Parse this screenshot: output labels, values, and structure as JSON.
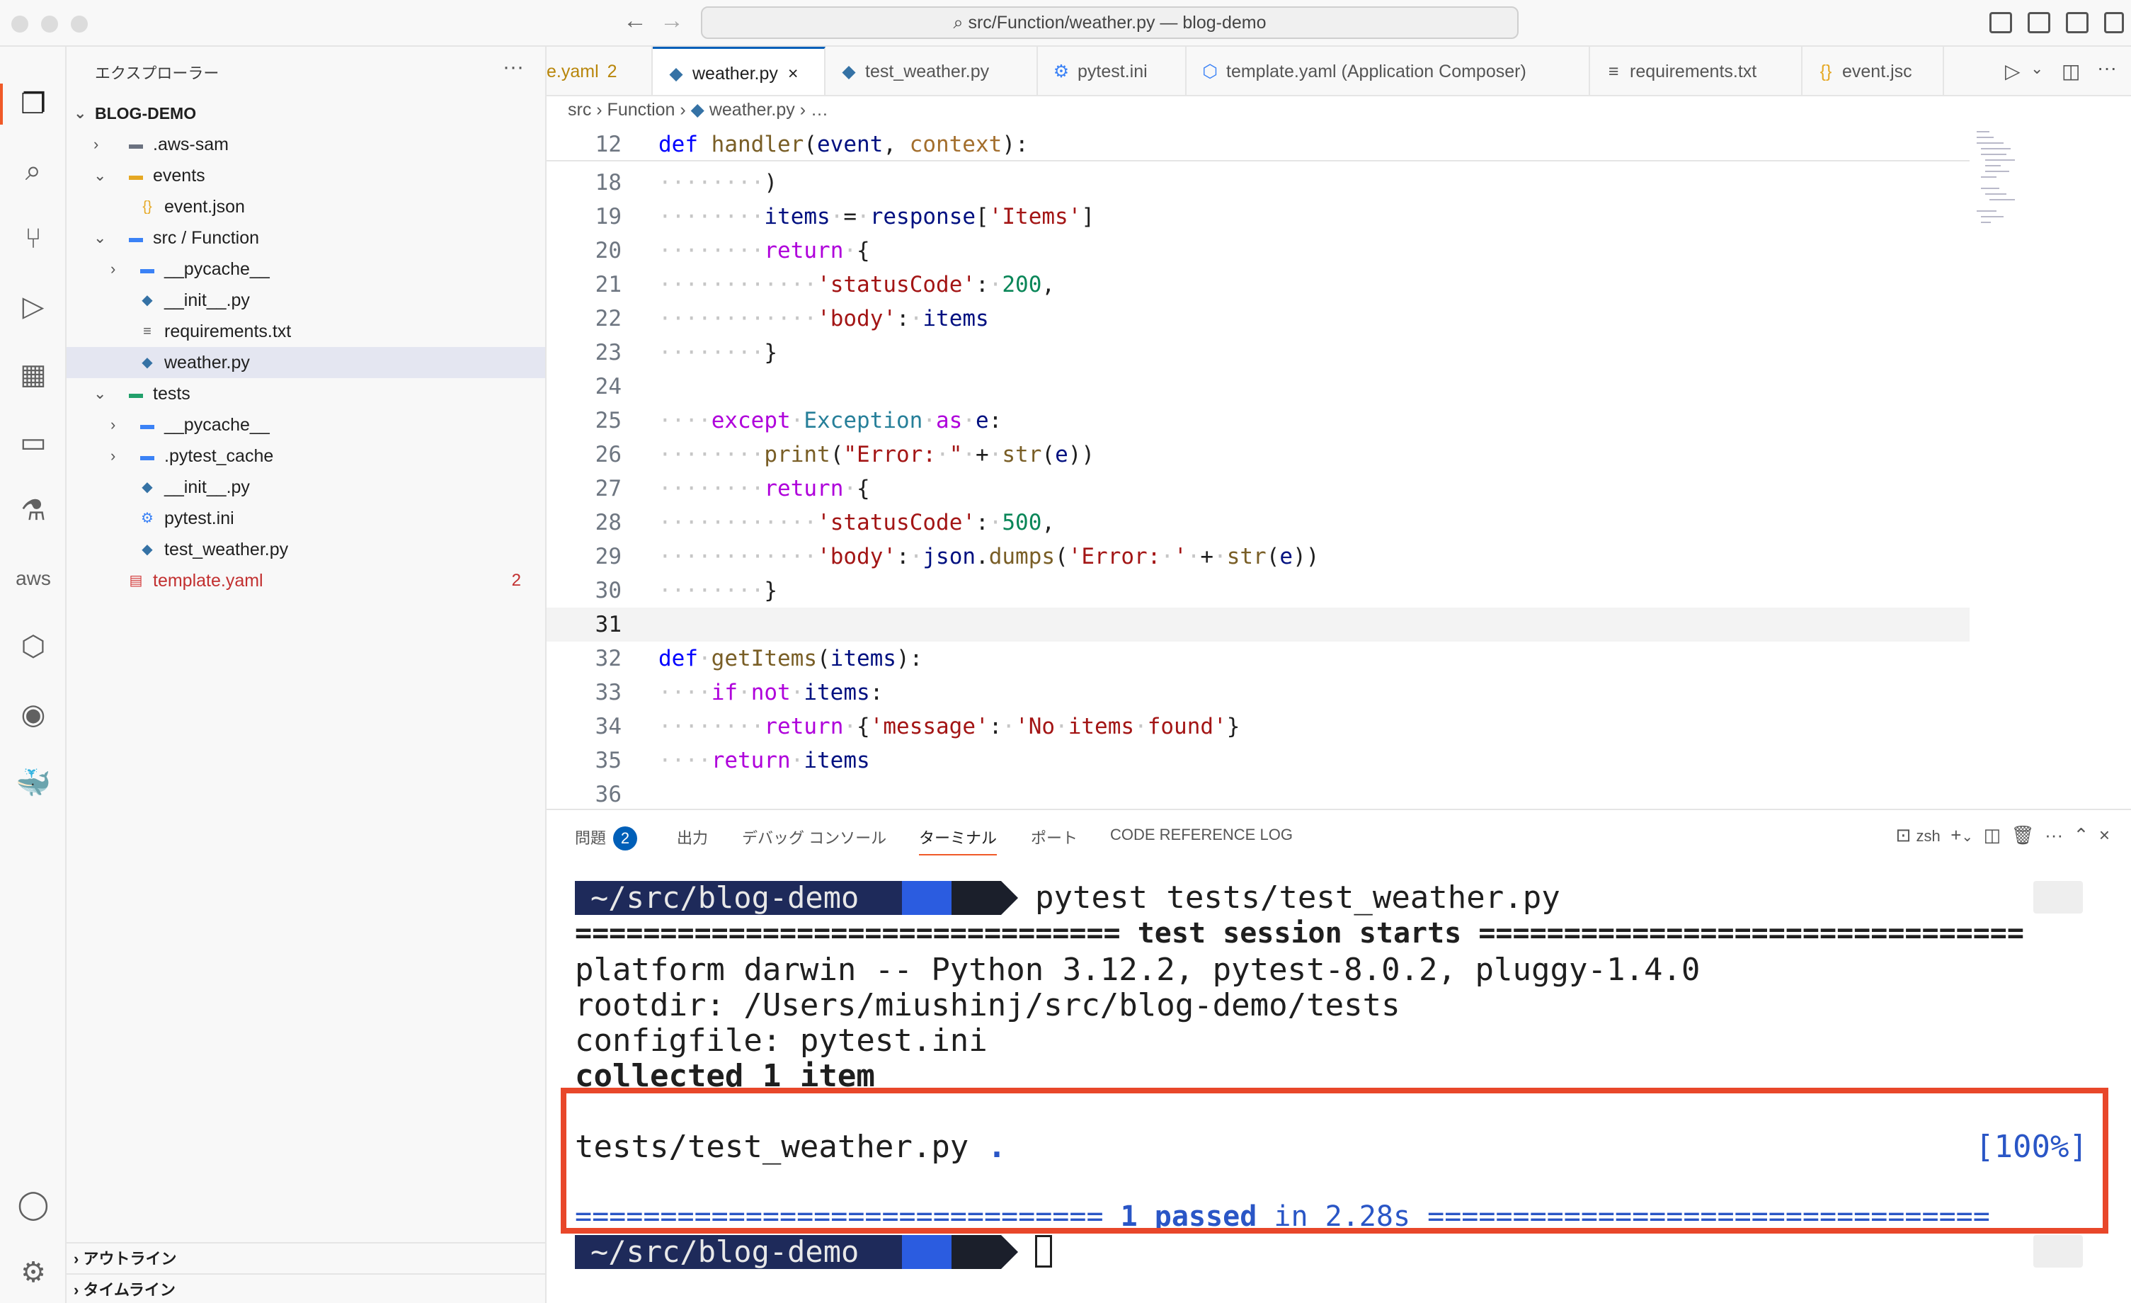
{
  "window": {
    "title": "src/Function/weather.py — blog-demo"
  },
  "explorer": {
    "title": "エクスプローラー",
    "root": "BLOG-DEMO",
    "items": [
      {
        "label": ".aws-sam",
        "indent": 1,
        "chevron": "›",
        "icon": "folder-icon",
        "color": "#6b7280"
      },
      {
        "label": "events",
        "indent": 1,
        "chevron": "⌄",
        "icon": "folder-icon",
        "color": "#e5a823"
      },
      {
        "label": "event.json",
        "indent": 2,
        "chevron": "",
        "icon": "json-icon",
        "color": "#e5a823"
      },
      {
        "label": "src / Function",
        "indent": 1,
        "chevron": "⌄",
        "icon": "folder-icon",
        "color": "#3b82f6"
      },
      {
        "label": "__pycache__",
        "indent": 2,
        "chevron": "›",
        "icon": "folder-icon",
        "color": "#3b82f6"
      },
      {
        "label": "__init__.py",
        "indent": 2,
        "chevron": "",
        "icon": "python-icon",
        "color": "#3572a5"
      },
      {
        "label": "requirements.txt",
        "indent": 2,
        "chevron": "",
        "icon": "text-file-icon",
        "color": "#555555"
      },
      {
        "label": "weather.py",
        "indent": 2,
        "chevron": "",
        "icon": "python-icon",
        "color": "#3572a5",
        "selected": true
      },
      {
        "label": "tests",
        "indent": 1,
        "chevron": "⌄",
        "icon": "folder-icon",
        "color": "#22a06b"
      },
      {
        "label": "__pycache__",
        "indent": 2,
        "chevron": "›",
        "icon": "folder-icon",
        "color": "#3b82f6"
      },
      {
        "label": ".pytest_cache",
        "indent": 2,
        "chevron": "›",
        "icon": "folder-icon",
        "color": "#3b82f6"
      },
      {
        "label": "__init__.py",
        "indent": 2,
        "chevron": "",
        "icon": "python-icon",
        "color": "#3572a5"
      },
      {
        "label": "pytest.ini",
        "indent": 2,
        "chevron": "",
        "icon": "gear-icon",
        "color": "#3b82f6"
      },
      {
        "label": "test_weather.py",
        "indent": 2,
        "chevron": "",
        "icon": "python-icon",
        "color": "#3572a5"
      },
      {
        "label": "template.yaml",
        "indent": 1,
        "chevron": "",
        "icon": "yaml-icon",
        "color": "#d33b3b",
        "badge": "2",
        "error": true
      }
    ],
    "outline": "アウトライン",
    "timeline": "タイムライン"
  },
  "tabs": [
    {
      "label": "e.yaml",
      "badge": "2",
      "icon": ""
    },
    {
      "label": "weather.py",
      "icon": "python-icon",
      "active": true,
      "close": "×"
    },
    {
      "label": "test_weather.py",
      "icon": "python-icon"
    },
    {
      "label": "pytest.ini",
      "icon": "gear-icon"
    },
    {
      "label": "template.yaml (Application Composer)",
      "icon": "composer-icon"
    },
    {
      "label": "requirements.txt",
      "icon": "text-file-icon"
    },
    {
      "label": "event.jsc",
      "icon": "json-icon"
    }
  ],
  "breadcrumb": {
    "parts": [
      "src",
      "Function",
      "weather.py",
      "…"
    ]
  },
  "code": {
    "sticky": {
      "ln": "12",
      "text": "def handler(event, context):"
    },
    "lines": [
      {
        "ln": "18",
        "text": "········)"
      },
      {
        "ln": "19",
        "text": "········items·=·response['Items']"
      },
      {
        "ln": "20",
        "text": "········return·{"
      },
      {
        "ln": "21",
        "text": "············'statusCode':·200,"
      },
      {
        "ln": "22",
        "text": "············'body':·items"
      },
      {
        "ln": "23",
        "text": "········}"
      },
      {
        "ln": "24",
        "text": ""
      },
      {
        "ln": "25",
        "text": "····except·Exception·as·e:"
      },
      {
        "ln": "26",
        "text": "········print(\"Error:·\"·+·str(e))"
      },
      {
        "ln": "27",
        "text": "········return·{"
      },
      {
        "ln": "28",
        "text": "············'statusCode':·500,"
      },
      {
        "ln": "29",
        "text": "············'body':·json.dumps('Error:·'·+·str(e))"
      },
      {
        "ln": "30",
        "text": "········}"
      },
      {
        "ln": "31",
        "text": "",
        "current": true
      },
      {
        "ln": "32",
        "text": "def·getItems(items):"
      },
      {
        "ln": "33",
        "text": "····if·not·items:"
      },
      {
        "ln": "34",
        "text": "········return·{'message':·'No·items·found'}"
      },
      {
        "ln": "35",
        "text": "····return·items"
      },
      {
        "ln": "36",
        "text": ""
      }
    ]
  },
  "panel": {
    "tabs": [
      "問題",
      "出力",
      "デバッグ コンソール",
      "ターミナル",
      "ポート",
      "CODE REFERENCE LOG"
    ],
    "problems_count": "2",
    "shell": "zsh"
  },
  "terminal": {
    "prompt": "~/src/blog-demo",
    "command": "pytest tests/test_weather.py",
    "lines": [
      "================================ test session starts ================================",
      "platform darwin -- Python 3.12.2, pytest-8.0.2, pluggy-1.4.0",
      "rootdir: /Users/miushinj/src/blog-demo/tests",
      "configfile: pytest.ini",
      "collected 1 item"
    ],
    "test_file": "tests/test_weather.py",
    "test_dot": ".",
    "percent": "[100%]",
    "summary_left": "=============================== ",
    "summary_mid": "1 passed",
    "summary_in": " in 2.28s ",
    "summary_right": "================================="
  },
  "colors": {
    "accent": "#005fb8",
    "highlight": "#e8472a",
    "prompt_bg": "#1e2a5a",
    "prompt_mid": "#2b5ce0"
  }
}
